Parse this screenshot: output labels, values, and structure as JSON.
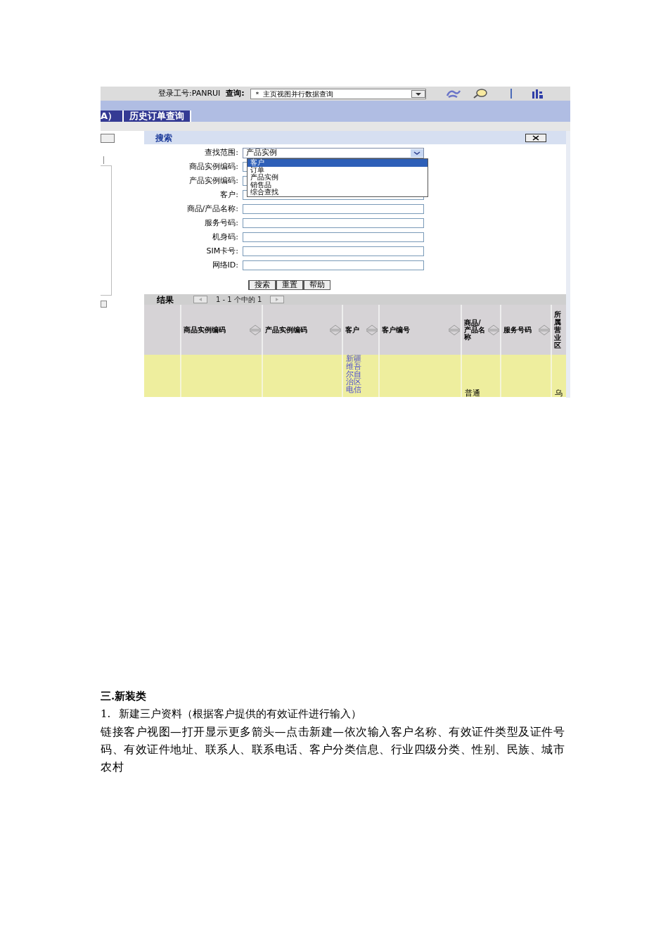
{
  "top_bar": {
    "login": "登录工号:PANRUI",
    "query_label": "查询:",
    "query_select": "＊ 主页视图并行数据查询"
  },
  "tabs": [
    {
      "label": "A）"
    },
    {
      "label": "历史订单查询"
    }
  ],
  "search_panel": {
    "title": "搜索",
    "fields": [
      {
        "label": "查找范围:",
        "kind": "select",
        "value": "产品实例"
      },
      {
        "label": "商品实例编码:",
        "kind": "text"
      },
      {
        "label": "产品实例编码:",
        "kind": "text"
      },
      {
        "label": "客户:",
        "kind": "text"
      },
      {
        "label": "商品/产品名称:",
        "kind": "text"
      },
      {
        "label": "服务号码:",
        "kind": "text"
      },
      {
        "label": "机身码:",
        "kind": "text"
      },
      {
        "label": "SIM卡号:",
        "kind": "text"
      },
      {
        "label": "网络ID:",
        "kind": "text"
      }
    ],
    "dropdown_options": [
      {
        "label": "客户",
        "selected": true
      },
      {
        "label": "订单",
        "selected": false
      },
      {
        "label": "产品实例",
        "selected": false
      },
      {
        "label": "销售品",
        "selected": false
      },
      {
        "label": "综合查找",
        "selected": false
      }
    ],
    "buttons": [
      "搜索",
      "重置",
      "帮助"
    ]
  },
  "results": {
    "title": "结果",
    "pager": "1 - 1 个中的 1",
    "columns": [
      {
        "sortable": false
      },
      {
        "label": "商品实例编码",
        "sortable": true
      },
      {
        "label": "产品实例编码",
        "sortable": true
      },
      {
        "label": "客户",
        "sortable": true,
        "cell": "新疆维吾尔自治区电信",
        "link": true
      },
      {
        "label": "客户编号",
        "sortable": true
      },
      {
        "label": "商品/产品名称",
        "sortable": true,
        "cell": "普通"
      },
      {
        "label": "服务号码",
        "sortable": true
      },
      {
        "label": "所属营业区",
        "sortable": false,
        "cell": "乌"
      }
    ]
  },
  "document": {
    "heading": "三.新装类",
    "item_number": "1.",
    "item_text": "新建三户资料（根据客户提供的有效证件进行输入）",
    "paragraph": "链接客户视图—打开显示更多箭头—点击新建—依次输入客户名称、有效证件类型及证件号码、有效证件地址、联系人、联系电话、客户分类信息、行业四级分类、性别、民族、城市农村"
  }
}
